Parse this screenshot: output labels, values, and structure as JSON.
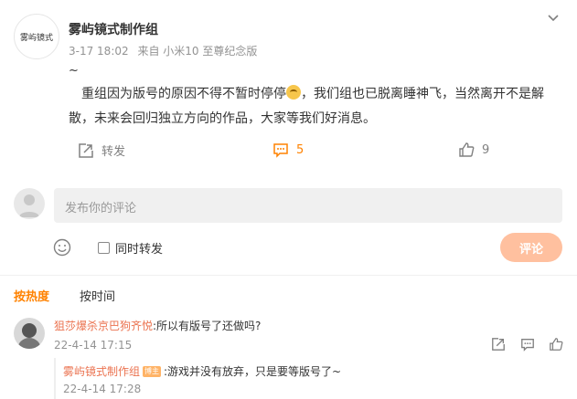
{
  "post": {
    "author": "雾屿镜式制作组",
    "logo_text": "雾屿镜式",
    "date": "3-17 18:02",
    "source": "来自 小米10 至尊纪念版",
    "tilde": "~",
    "content_part1": "重组因为版号的原因不得不暂时停停",
    "content_part2": "，我们组也已脱离睡神飞，当然离开不是解散，未来会回归独立方向的作品，大家等我们好消息。",
    "emoji_icon": "wink-face-emoji"
  },
  "actions": {
    "forward_label": "转发",
    "comment_count": "5",
    "like_count": "9"
  },
  "compose": {
    "placeholder": "发布你的评论",
    "also_forward_label": "同时转发",
    "submit_label": "评论"
  },
  "sort": {
    "hot_label": "按热度",
    "time_label": "按时间"
  },
  "comments": [
    {
      "user": "狙莎爆杀京巴狗齐悦",
      "text": ":所以有版号了还做吗?",
      "time": "22-4-14 17:15",
      "reply": {
        "user": "雾屿镜式制作组",
        "badge": "博主",
        "text": ":游戏并没有放弃，只是要等版号了~",
        "time": "22-4-14 17:28"
      }
    }
  ],
  "colors": {
    "accent": "#ff8200",
    "username": "#eb7350",
    "submit_disabled": "#ffc09f"
  }
}
